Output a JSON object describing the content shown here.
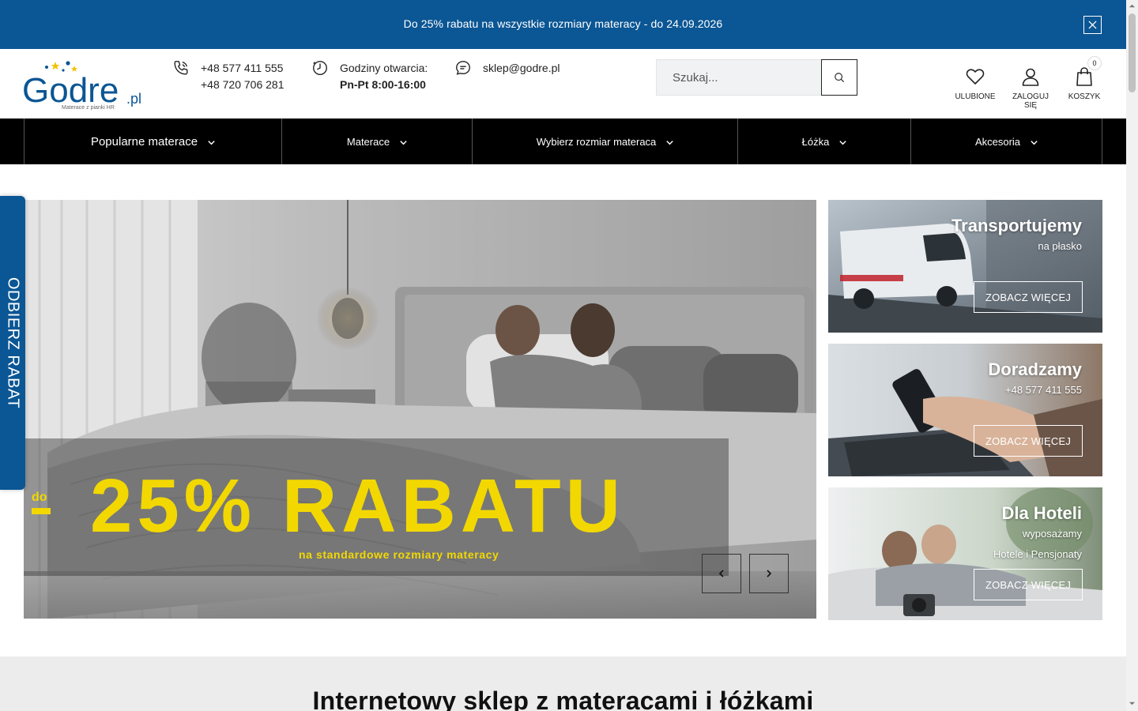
{
  "promo_bar": {
    "text": "Do 25% rabatu na wszystkie rozmiary materacy - do 24.09.2026",
    "close_icon": "close-icon"
  },
  "header": {
    "logo": {
      "text": "Godre",
      "suffix": ".pl",
      "tagline": "Materace z pianki HR"
    },
    "phone": {
      "icon": "phone-icon",
      "line1": "+48 577 411 555",
      "line2": "+48 720 706 281"
    },
    "hours": {
      "icon": "clock-icon",
      "label": "Godziny otwarcia:",
      "value": "Pn-Pt 8:00-16:00"
    },
    "email": {
      "icon": "chat-icon",
      "value": "sklep@godre.pl"
    },
    "search": {
      "placeholder": "Szukaj...",
      "icon": "search-icon"
    },
    "actions": [
      {
        "label": "ULUBIONE",
        "icon": "heart-icon"
      },
      {
        "label": "ZALOGUJ SIĘ",
        "icon": "user-icon"
      },
      {
        "label": "KOSZYK",
        "icon": "bag-icon",
        "count": "0"
      }
    ]
  },
  "nav": {
    "items": [
      {
        "label": "Popularne materace"
      },
      {
        "label": "Materace"
      },
      {
        "label": "Wybierz rozmiar materaca"
      },
      {
        "label": "Łóżka"
      },
      {
        "label": "Akcesoria"
      }
    ]
  },
  "side_tab": {
    "label": "ODBIERZ RABAT"
  },
  "hero": {
    "prefix": "do",
    "headline": "25% RABATU",
    "subline": "na standardowe rozmiary materacy",
    "prev_icon": "chevron-left-icon",
    "next_icon": "chevron-right-icon"
  },
  "cards": [
    {
      "title": "Transportujemy",
      "lines": [
        "na płasko"
      ],
      "button": "ZOBACZ WIĘCEJ"
    },
    {
      "title": "Doradzamy",
      "lines": [
        "+48 577 411 555"
      ],
      "button": "ZOBACZ WIĘCEJ"
    },
    {
      "title": "Dla Hoteli",
      "lines": [
        "wyposażamy",
        "Hotele i Pensjonaty"
      ],
      "button": "ZOBACZ WIĘCEJ"
    }
  ],
  "intro": {
    "heading": "Internetowy sklep z materacami i łóżkami"
  },
  "colors": {
    "brand_blue": "#0b5694",
    "nav_bg": "#000000",
    "hero_yellow": "#f2d800",
    "star_yellow": "#f2c200"
  }
}
